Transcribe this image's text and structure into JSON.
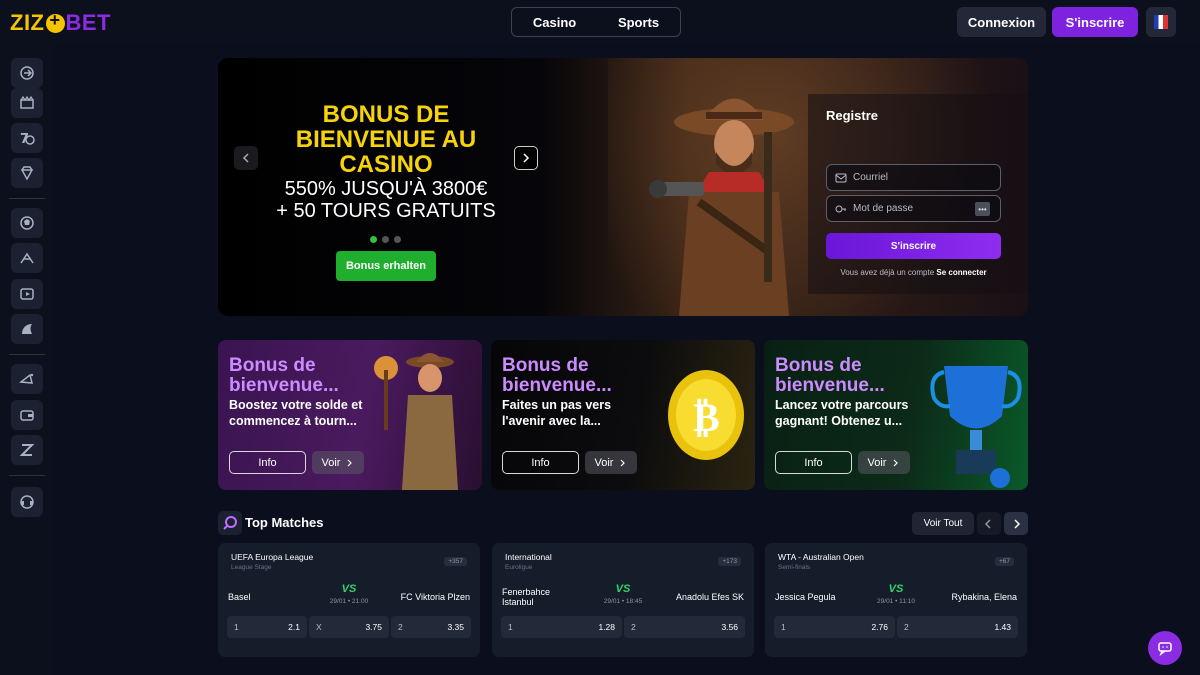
{
  "brand": {
    "part1": "ZIZ",
    "part2": "BET"
  },
  "nav": {
    "casino": "Casino",
    "sports": "Sports"
  },
  "header": {
    "login": "Connexion",
    "signup": "S'inscrire",
    "language_flag": "flag-fr-icon"
  },
  "sidebar": {
    "items": [
      "logout-icon",
      "casino-icon",
      "slots-icon",
      "diamond-icon",
      "soccer-icon",
      "sports-icon",
      "video-icon",
      "esports-icon",
      "promotions-icon",
      "wallet-icon",
      "zizo-icon",
      "support-icon"
    ]
  },
  "hero": {
    "title": "BONUS DE BIENVENUE AU CASINO",
    "subtitle_line1": "550% JUSQU'À 3800€",
    "subtitle_line2": "+ 50 TOURS GRATUITS",
    "cta": "Bonus erhalten",
    "slides": 3,
    "active_slide": 1
  },
  "register": {
    "title": "Registre",
    "email_placeholder": "Courriel",
    "password_placeholder": "Mot de passe",
    "submit": "S'inscrire",
    "note": "Vous avez déjà un compte",
    "note_link": "Se connecter"
  },
  "promos": [
    {
      "title_line1": "Bonus de",
      "title_line2": "bienvenue...",
      "desc_line1": "Boostez votre solde et",
      "desc_line2": "commencez à tourn...",
      "info": "Info",
      "voir": "Voir"
    },
    {
      "title_line1": "Bonus de",
      "title_line2": "bienvenue...",
      "desc_line1": "Faites un pas vers",
      "desc_line2": "l'avenir avec la...",
      "info": "Info",
      "voir": "Voir"
    },
    {
      "title_line1": "Bonus de",
      "title_line2": "bienvenue...",
      "desc_line1": "Lancez votre parcours",
      "desc_line2": "gagnant! Obtenez u...",
      "info": "Info",
      "voir": "Voir"
    }
  ],
  "top_matches": {
    "title": "Top Matches",
    "voir_tout": "Voir Tout",
    "matches": [
      {
        "league": "UEFA Europa League",
        "stage": "League Stage",
        "count": "+357",
        "home": "Basel",
        "away": "FC Viktoria Plzen",
        "vs": "VS",
        "time": "29/01 • 21:00",
        "odds": [
          {
            "label": "1",
            "value": "2.1"
          },
          {
            "label": "X",
            "value": "3.75"
          },
          {
            "label": "2",
            "value": "3.35"
          }
        ]
      },
      {
        "league": "International",
        "stage": "Euroligue",
        "count": "+173",
        "home": "Fenerbahce Istanbul",
        "away": "Anadolu Efes SK",
        "vs": "VS",
        "time": "29/01 • 18:45",
        "odds": [
          {
            "label": "1",
            "value": "1.28"
          },
          {
            "label": "2",
            "value": "3.56"
          }
        ]
      },
      {
        "league": "WTA - Australian Open",
        "stage": "Semi-finals",
        "count": "+67",
        "home": "Jessica Pegula",
        "away": "Rybakina, Elena",
        "vs": "VS",
        "time": "29/01 • 11:10",
        "odds": [
          {
            "label": "1",
            "value": "2.76"
          },
          {
            "label": "2",
            "value": "1.43"
          }
        ]
      }
    ]
  },
  "colors": {
    "accent": "#7f22e0",
    "hero_title": "#f6d30a",
    "cta_green": "#1fae2d",
    "vs_green": "#39d26a",
    "promo_title": "#cc8cff"
  }
}
